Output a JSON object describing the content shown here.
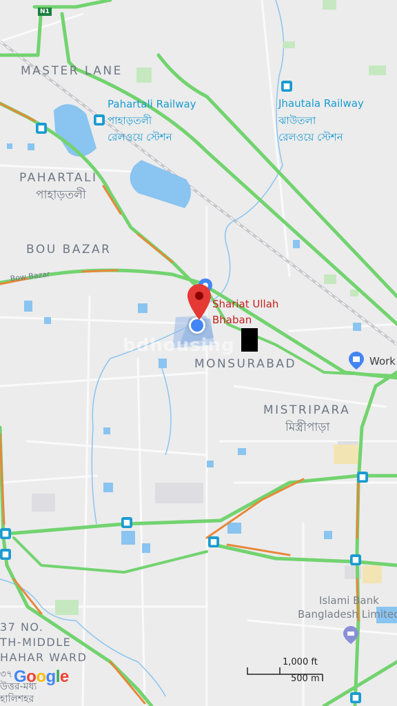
{
  "map": {
    "areas": {
      "master_lane": "MASTER LANE",
      "pahartali": "PAHARTALI",
      "pahartali_bn": "পাহাড়তলী",
      "bou_bazar": "BOU BAZAR",
      "monsurabad": "MONSURABAD",
      "mistripara": "MISTRIPARA",
      "mistripara_bn": "মিস্ত্রীপাড়া",
      "ward_line1": "37 NO.",
      "ward_line2": "TH-MIDDLE",
      "ward_line3": "HAHAR WARD",
      "ward_bn_line1": "৩৭",
      "ward_bn_line2": "উত্তর-মধ্য",
      "ward_bn_line3": "হালিশহর"
    },
    "pois": {
      "pahartali_rail": "Pahartali Railway",
      "pahartali_rail_bn": "পাহাড়তলী",
      "pahartali_rail_bn2": "রেলওয়ে স্টেশন",
      "jhautala_rail": "Jhautala Railway",
      "jhautala_rail_bn": "ঝাউতলা",
      "jhautala_rail_bn2": "রেলওয়ে স্টেশন",
      "work": "Work",
      "islami_bank_line1": "Islami Bank",
      "islami_bank_line2": "Bangladesh Limited"
    },
    "roads": {
      "bow_bazar": "Bow Bazar",
      "n1": "N1"
    },
    "selected_place": {
      "line1": "Shariat Ullah",
      "line2": "Bhaban"
    },
    "watermark": "bdhousing",
    "scale": {
      "imperial": "1,000 ft",
      "metric": "500 m"
    },
    "logo": "Google",
    "colors": {
      "land": "#ececec",
      "water": "#8ac4f0",
      "road_green": "#72d36f",
      "road_orange": "#e8873a",
      "transit_blue": "#1a9bd0",
      "marker_red": "#e53935",
      "location_blue": "#4285f4"
    },
    "icons": {
      "rail": "train-station-icon",
      "bus": "bus-stop-icon",
      "pin": "map-pin-icon",
      "location": "current-location-icon",
      "bank": "bank-icon",
      "work": "work-place-icon"
    }
  }
}
